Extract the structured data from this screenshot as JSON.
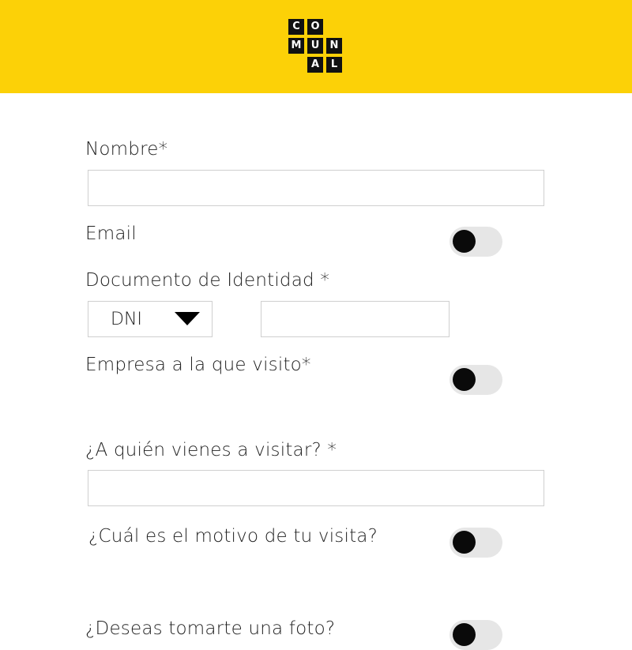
{
  "brand": {
    "logo_letters": [
      "C",
      "O",
      "M",
      "U",
      "N",
      "A",
      "L"
    ]
  },
  "form": {
    "nombre": {
      "label": "Nombre*",
      "value": ""
    },
    "email": {
      "label": "Email",
      "toggle_on": false
    },
    "documento": {
      "label": "Documento de Identidad *",
      "type_selected": "DNI",
      "number_value": ""
    },
    "empresa": {
      "label": "Empresa a la que visito*",
      "toggle_on": false
    },
    "quien": {
      "label": "¿A quién vienes a visitar?  *",
      "value": ""
    },
    "motivo": {
      "label": "¿Cuál es el motivo de tu visita?",
      "toggle_on": false
    },
    "foto": {
      "label": "¿Deseas tomarte una foto?",
      "toggle_on": false
    }
  }
}
